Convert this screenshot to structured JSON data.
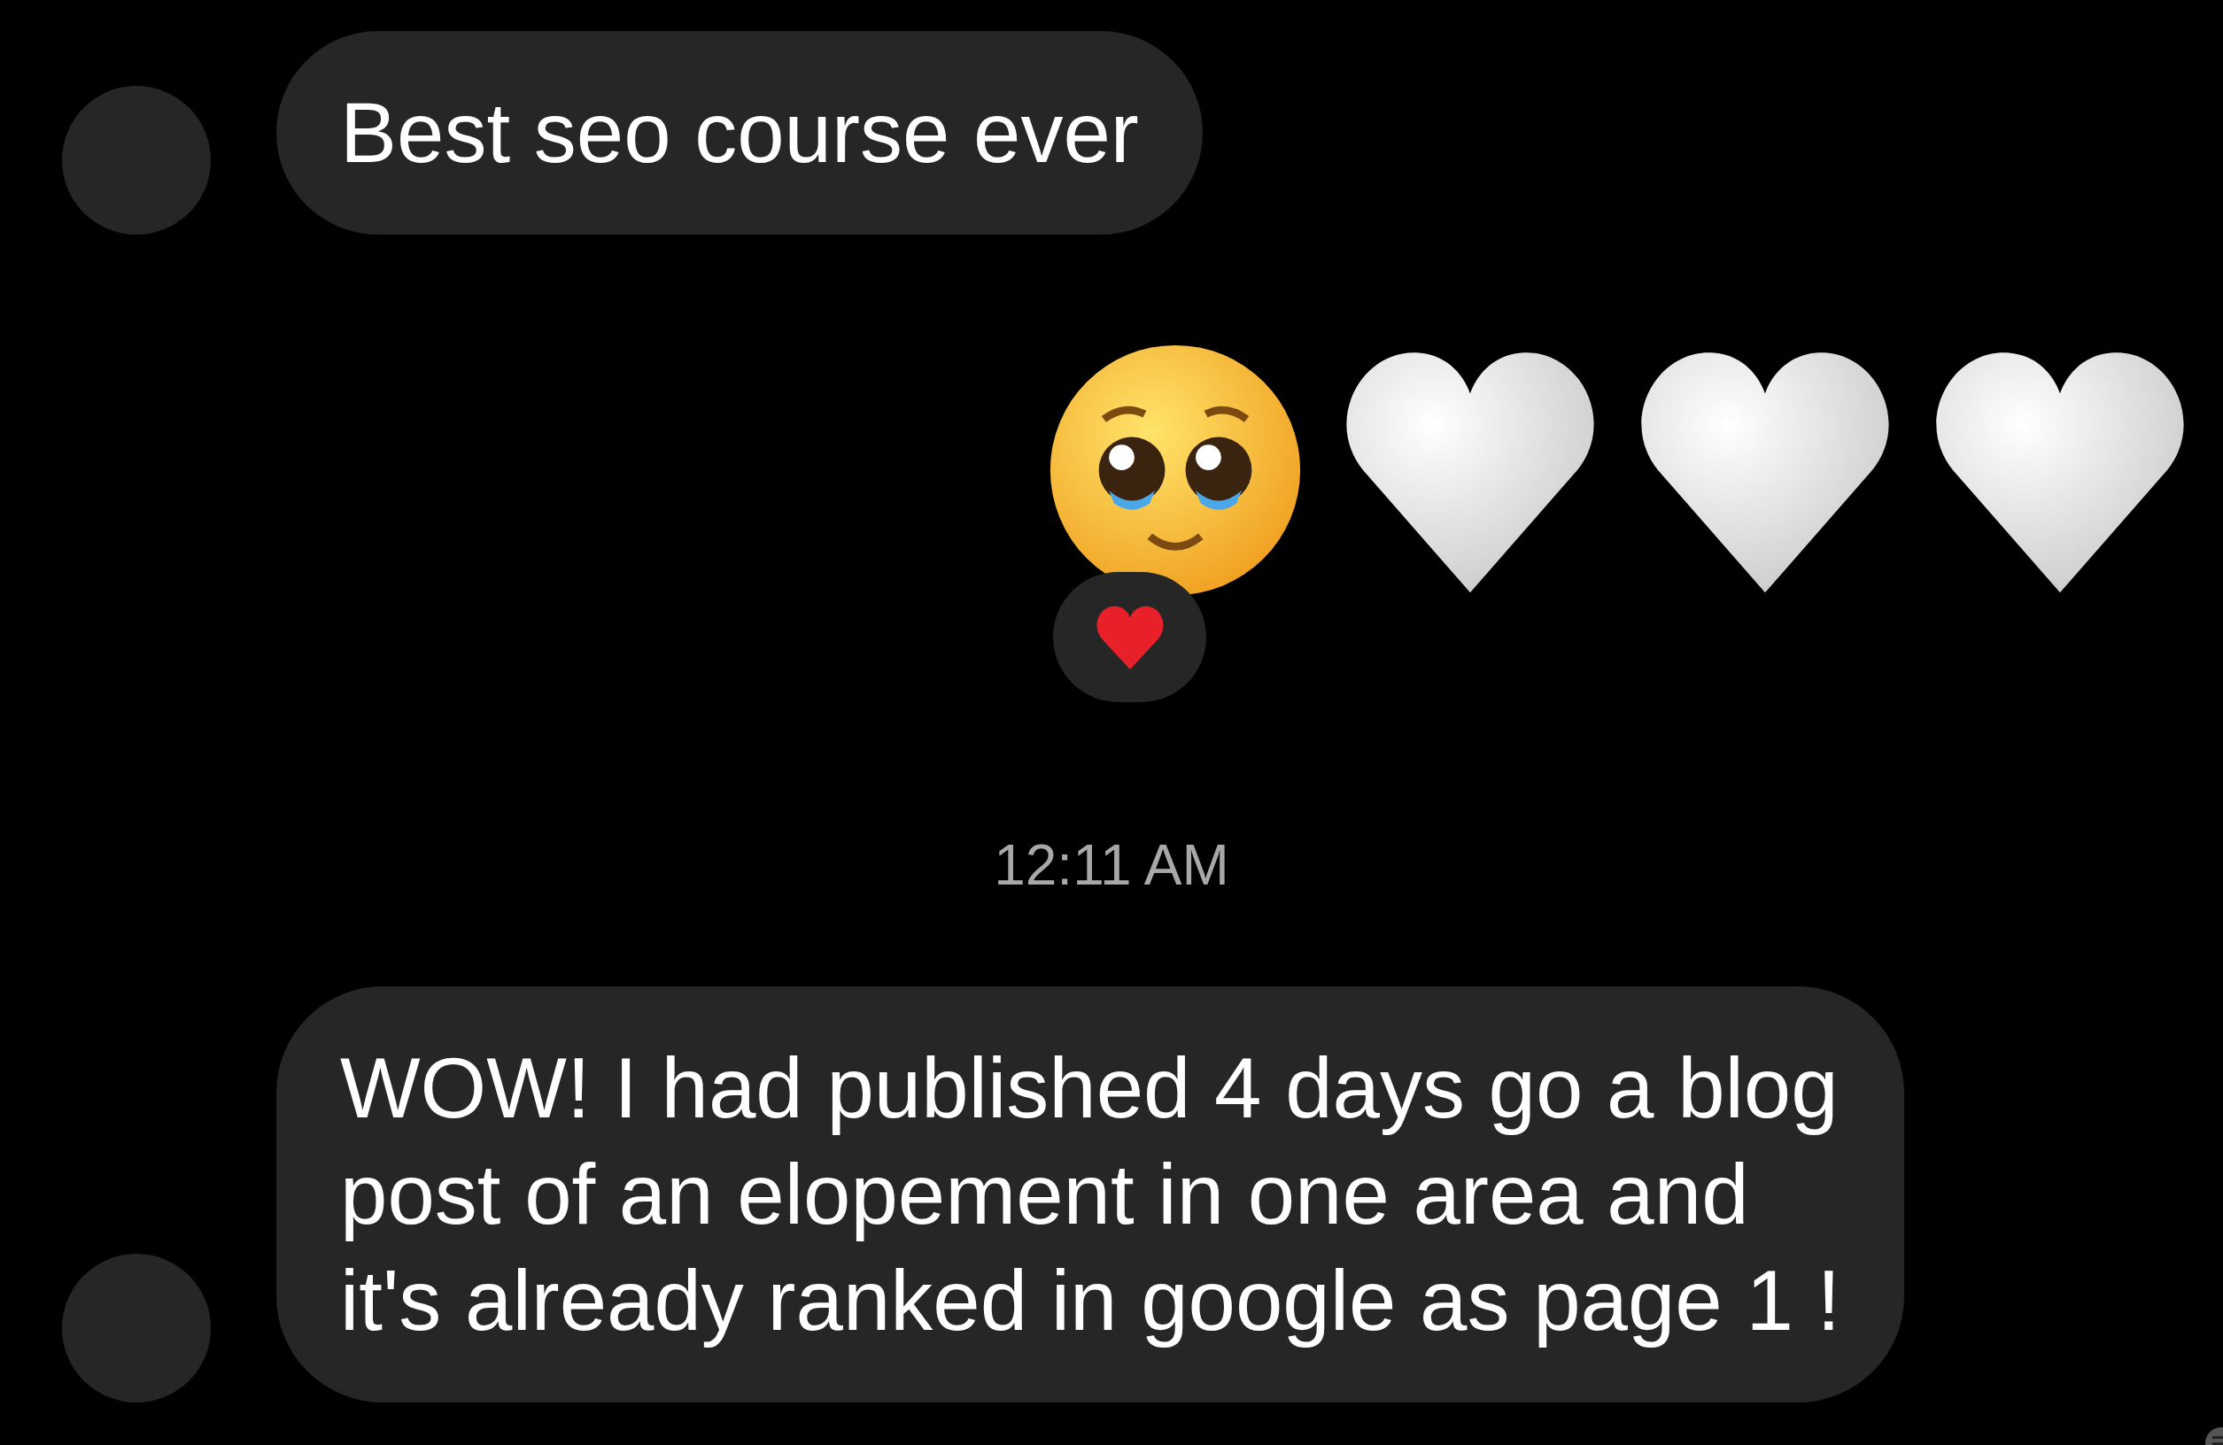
{
  "messages": [
    {
      "kind": "text",
      "outgoing": false,
      "lines": [
        "Best seo course ever"
      ]
    },
    {
      "kind": "emoji",
      "outgoing": true,
      "items": [
        {
          "kind": "pleading-face"
        },
        {
          "kind": "white-heart"
        },
        {
          "kind": "white-heart"
        },
        {
          "kind": "white-heart"
        }
      ],
      "reaction": {
        "kind": "red-heart"
      }
    },
    {
      "kind": "time",
      "text": "12:11 AM"
    },
    {
      "kind": "text",
      "outgoing": false,
      "lines": [
        "WOW! I had published 4 days go a blog",
        "post of an elopement in one area and",
        "it's already ranked in google as page 1 !"
      ]
    }
  ]
}
